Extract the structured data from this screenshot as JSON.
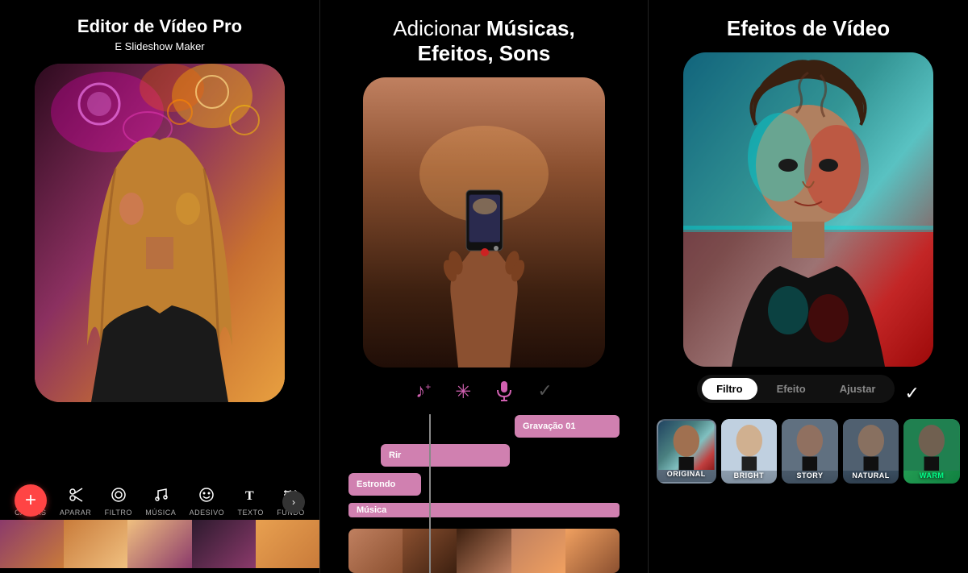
{
  "panels": [
    {
      "id": "panel-1",
      "title": "Editor de Vídeo Pro",
      "subtitle": "E Slideshow Maker",
      "toolbar": {
        "items": [
          {
            "icon": "⬜",
            "label": "CANVAS"
          },
          {
            "icon": "✂",
            "label": "APARAR"
          },
          {
            "icon": "◉",
            "label": "FILTRO"
          },
          {
            "icon": "♪",
            "label": "MÚSICA"
          },
          {
            "icon": "☺",
            "label": "ADESIVO"
          },
          {
            "icon": "T",
            "label": "TEXTO"
          },
          {
            "icon": "≋",
            "label": "FUNDO"
          }
        ]
      },
      "add_button": "+",
      "next_arrow": "›"
    },
    {
      "id": "panel-2",
      "title_plain": "Adicionar ",
      "title_bold": "Músicas, Efeitos, Sons",
      "audio_icons": [
        "♪+",
        "✳",
        "🎤",
        "✓"
      ],
      "tracks": [
        {
          "label": "Gravação 01",
          "type": "gravacao"
        },
        {
          "label": "Rir",
          "type": "rir"
        },
        {
          "label": "Estrondo",
          "type": "estrondo"
        },
        {
          "label": "Música",
          "type": "musica"
        }
      ]
    },
    {
      "id": "panel-3",
      "title": "Efeitos de Vídeo",
      "tabs": [
        "Filtro",
        "Efeito",
        "Ajustar"
      ],
      "active_tab": "Filtro",
      "filter_thumbnails": [
        {
          "label": "ORIGINAL",
          "style": "original"
        },
        {
          "label": "BRIGHT",
          "style": "bright"
        },
        {
          "label": "STORY",
          "style": "story"
        },
        {
          "label": "NATURAL",
          "style": "natural"
        },
        {
          "label": "WARM",
          "style": "warm"
        }
      ]
    }
  ]
}
